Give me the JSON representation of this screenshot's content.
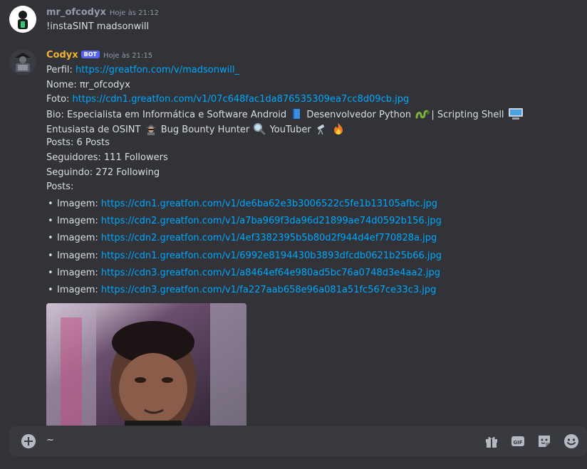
{
  "message1": {
    "username": "mr_ofcodyx",
    "timestamp": "Hoje às 21:12",
    "text": "!instaSINT madsonwill"
  },
  "message2": {
    "username": "Codyx",
    "bot_badge": "BOT",
    "timestamp": "Hoje às 21:15",
    "perfil_label": "Perfil: ",
    "perfil_url": "https://greatfon.com/v/madsonwill_",
    "nome": "Nome: πr_ofcodyx",
    "foto_label": "Foto: ",
    "foto_url": "https://cdn1.greatfon.com/v1/07c648fac1da876535309ea7cc8d09cb.jpg",
    "bio_part1": "Bio: Especialista em Informática e Software Android",
    "bio_part2": "Desenvolvedor Python",
    "bio_part3": "| Scripting Shell",
    "bio_part4": "Entusiasta de OSINT",
    "bio_part5": "Bug Bounty Hunter",
    "bio_part6": "YouTuber",
    "posts": "Posts: 6 Posts",
    "seguidores": "Seguidores: 111 Followers",
    "seguindo": "Seguindo: 272 Following",
    "posts_label": "Posts:",
    "image_label": "Imagem: ",
    "images": [
      "https://cdn1.greatfon.com/v1/de6ba62e3b3006522c5fe1b13105afbc.jpg",
      "https://cdn2.greatfon.com/v1/a7ba969f3da96d21899ae74d0592b156.jpg",
      "https://cdn2.greatfon.com/v1/4ef3382395b5b80d2f944d4ef770828a.jpg",
      "https://cdn1.greatfon.com/v1/6992e8194430b3893dfcdb0621b25b66.jpg",
      "https://cdn3.greatfon.com/v1/a8464ef64e980ad5bc76a0748d3e4aa2.jpg",
      "https://cdn3.greatfon.com/v1/fa227aab658e96a081a51fc567ce33c3.jpg"
    ],
    "bullet": "•"
  },
  "composer": {
    "value": "~"
  },
  "colors": {
    "background": "#313338",
    "link": "#00a8fc",
    "bot_name": "#f0b232",
    "user_name": "#949ba4",
    "badge": "#5865f2"
  },
  "icons": [
    "add-attachment-icon",
    "gift-icon",
    "gif-icon",
    "sticker-icon",
    "emoji-icon"
  ]
}
